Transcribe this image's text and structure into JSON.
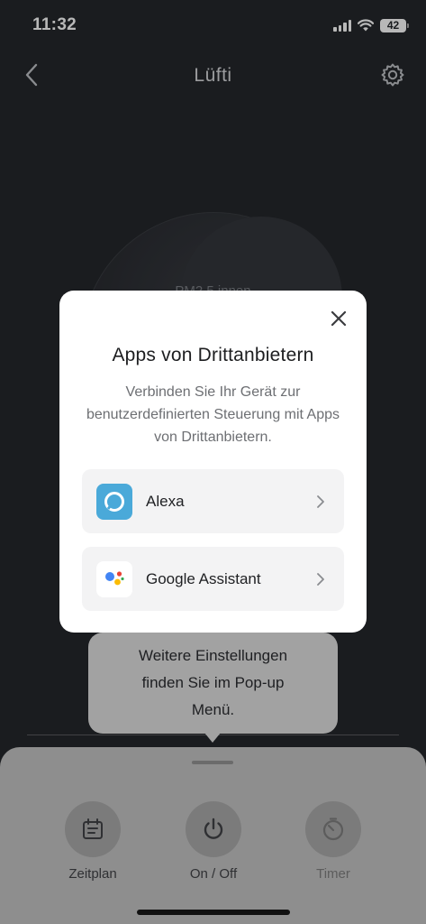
{
  "status_bar": {
    "time": "11:32",
    "battery": "42"
  },
  "nav": {
    "title": "Lüfti"
  },
  "device": {
    "label": "PM2.5 innen"
  },
  "dialog": {
    "title": "Apps von Drittanbietern",
    "description": "Verbinden Sie Ihr Gerät zur benutzerdefinierten Steuerung mit Apps von Drittanbietern.",
    "apps": [
      {
        "label": "Alexa",
        "icon": "alexa-icon",
        "color": "#4aa9d9"
      },
      {
        "label": "Google Assistant",
        "icon": "google-assistant-icon"
      }
    ]
  },
  "tooltip": {
    "text_lines": [
      "Weitere Einstellungen",
      "finden Sie im Pop-up",
      "Menü."
    ]
  },
  "controls": [
    {
      "label": "Zeitplan",
      "icon": "schedule-icon"
    },
    {
      "label": "On / Off",
      "icon": "power-icon"
    },
    {
      "label": "Timer",
      "icon": "timer-icon"
    }
  ]
}
